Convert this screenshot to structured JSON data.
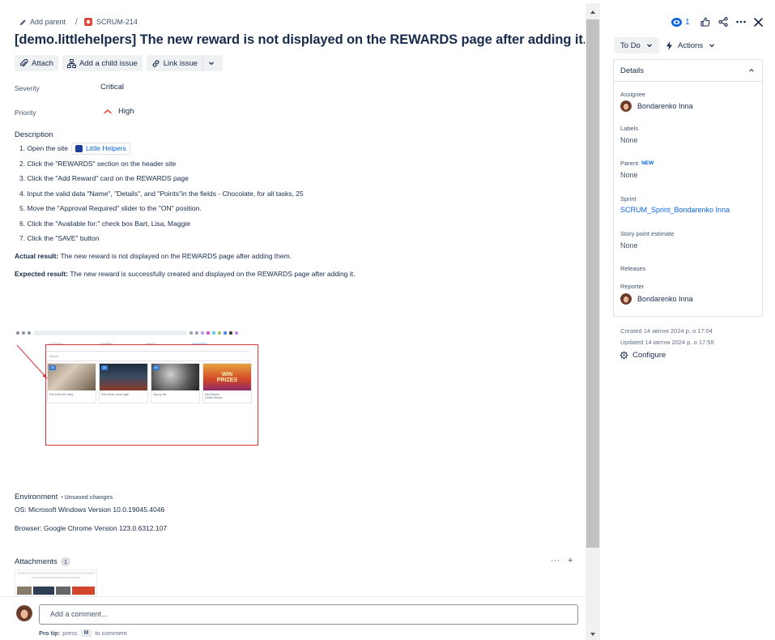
{
  "breadcrumb": {
    "add_parent": "Add parent",
    "separator": "/",
    "issue_key": "SCRUM-214"
  },
  "issue": {
    "title": "[demo.littlehelpers] The new reward is not displayed on the REWARDS page after adding it."
  },
  "toolbar": {
    "attach": "Attach",
    "add_child": "Add a child issue",
    "link_issue": "Link issue"
  },
  "fields": {
    "severity_label": "Severity",
    "severity_value": "Critical",
    "priority_label": "Priority",
    "priority_value": "High",
    "priority_color": "#e2483d"
  },
  "description": {
    "heading": "Description",
    "step1_prefix": "1. Open the site",
    "step1_link": "Little Helpers",
    "steps": [
      "2. Click the \"REWARDS\" section on the header site",
      "3. Click the \"Add Reward\" card on the REWARDS page",
      "4. Input the valid data \"Name\", \"Details\", and \"Points\"in the fields - Chocolate, for all tasks, 25",
      "5. Move the \"Approval Required\" slider to the \"ON\" position.",
      "6. Click the \"Available for:\" check box Bart, Lisa, Maggie",
      "7. Click the \"SAVE\" button"
    ],
    "actual_label": "Actual result:",
    "actual_text": " The new reward is not displayed on the REWARDS page after adding them.",
    "expected_label": "Expected result:",
    "expected_text": " The new reward is successfully created and displayed on the REWARDS page after adding it."
  },
  "screenshot": {
    "tabs": [
      "ACTIVITY",
      "CHORES",
      "WANTS",
      "REWARDS"
    ],
    "search": "Search",
    "cards": [
      {
        "points": "25",
        "caption": "Pick a friend to hang..."
      },
      {
        "points": "30",
        "caption": "Kid's choice movie night"
      },
      {
        "points": "50",
        "caption": "Stay up late"
      },
      {
        "points": "",
        "caption": "Add Reward\nCreate Reward"
      }
    ],
    "win_text": "WIN\nPRIZES"
  },
  "environment": {
    "label": "Environment",
    "unsaved": "• Unsaved changes",
    "os": "OS: Microsoft Windows Version 10.0.19045.4046",
    "browser": "Browser: Google Chrome Version 123.0.6312.107"
  },
  "attachments": {
    "label": "Attachments",
    "count": "1",
    "more": "···",
    "add": "+"
  },
  "comment": {
    "placeholder": "Add a comment...",
    "protip_label": "Pro tip:",
    "protip_press": "press",
    "protip_key": "M",
    "protip_suffix": "to comment"
  },
  "header": {
    "watch_count": "1"
  },
  "status": {
    "label": "To Do",
    "actions": "Actions"
  },
  "details": {
    "heading": "Details",
    "assignee_label": "Assignee",
    "assignee": "Bondarenko Inna",
    "labels_label": "Labels",
    "labels_value": "None",
    "parent_label": "Parent",
    "parent_badge": "NEW",
    "parent_value": "None",
    "sprint_label": "Sprint",
    "sprint_value": "SCRUM_Sprint_Bondarenko Inna",
    "story_label": "Story point estimate",
    "story_value": "None",
    "releases_label": "Releases",
    "reporter_label": "Reporter",
    "reporter": "Bondarenko Inna"
  },
  "meta": {
    "created": "Created 14 квітня 2024 р. о 17:04",
    "updated": "Updated 14 квітня 2024 р. о 17:56",
    "configure": "Configure"
  },
  "colors": {
    "link": "#0c66e4",
    "text": "#172b4d",
    "subtle": "#44546f",
    "button_bg": "#f0f1f3",
    "border": "#dcdfe4",
    "issue_type": "#e2483d"
  },
  "icons": [
    "pencil-icon",
    "bug-issue-icon",
    "paperclip-icon",
    "hierarchy-icon",
    "link-icon",
    "chevron-down-icon",
    "priority-high-icon",
    "eye-icon",
    "thumbs-up-icon",
    "share-icon",
    "more-icon",
    "close-icon",
    "lightning-icon",
    "chevron-up-icon",
    "gear-icon"
  ]
}
